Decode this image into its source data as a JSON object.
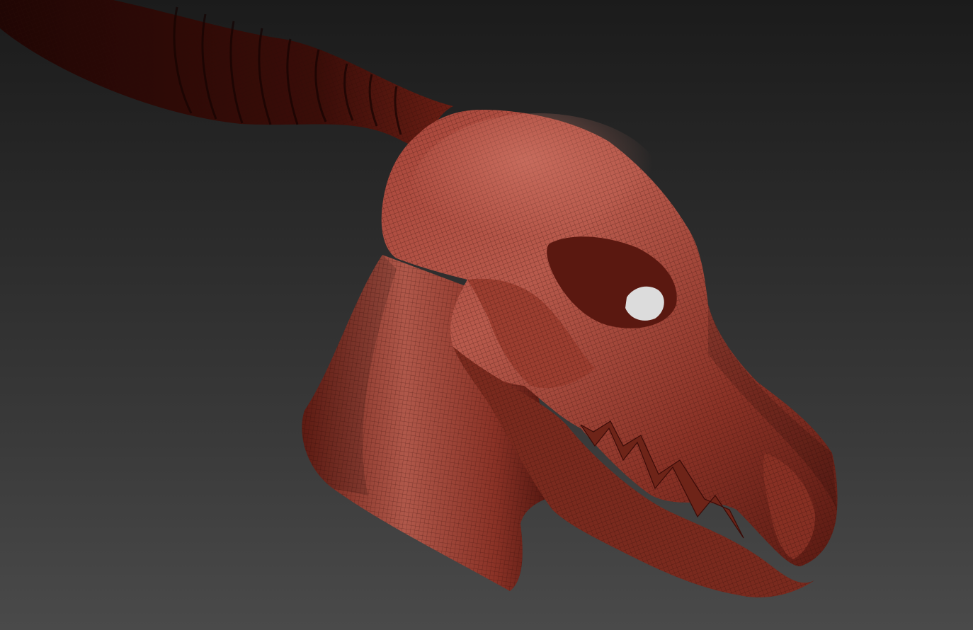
{
  "scene": {
    "subject": "creature-skull-sculpt",
    "colors": {
      "background_top": "#1b1b1b",
      "background_bottom": "#4a4a4a",
      "mesh_base": "#9a3a2c",
      "mesh_highlight": "#c8685a",
      "mesh_shadow": "#3a0c08",
      "horn": "#2a0806",
      "wire": "#2a0a06"
    }
  }
}
